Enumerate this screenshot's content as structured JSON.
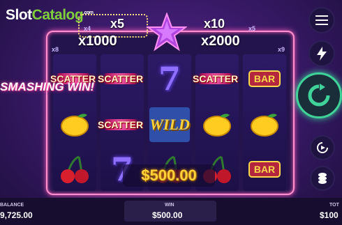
{
  "logo": {
    "part1": "Slot",
    "part2": "Catalog",
    "sup": ".com"
  },
  "multipliers": {
    "left_top": "x5",
    "left_top_small": "x4",
    "left_main": "x1000",
    "left_small": "x8",
    "right_top": "x10",
    "right_top_small": "x5",
    "right_main": "x2000",
    "right_small": "x9"
  },
  "reels": [
    [
      "SCATTER",
      "lemon",
      "cherries"
    ],
    [
      "SCATTER",
      "SCATTER",
      "7"
    ],
    [
      "7",
      "WILD",
      "cherries"
    ],
    [
      "SCATTER",
      "lemon",
      "cherries"
    ],
    [
      "BAR",
      "lemon",
      "BAR"
    ]
  ],
  "win_overlay": "$500.00",
  "smashing_win": "SMASHING WIN!",
  "side_buttons": [
    "menu-icon",
    "lightning-icon",
    "spin-icon",
    "autoplay-icon",
    "coins-icon"
  ],
  "bottom": {
    "balance_label": "BALANCE",
    "balance_value": "9,725.00",
    "win_label": "WIN",
    "win_value": "$500.00",
    "total_label": "TOT",
    "total_value": "$100"
  },
  "colors": {
    "frame": "#ff8fcf",
    "win_gold": "#ffd23a",
    "spin_green": "#3fd39a"
  }
}
